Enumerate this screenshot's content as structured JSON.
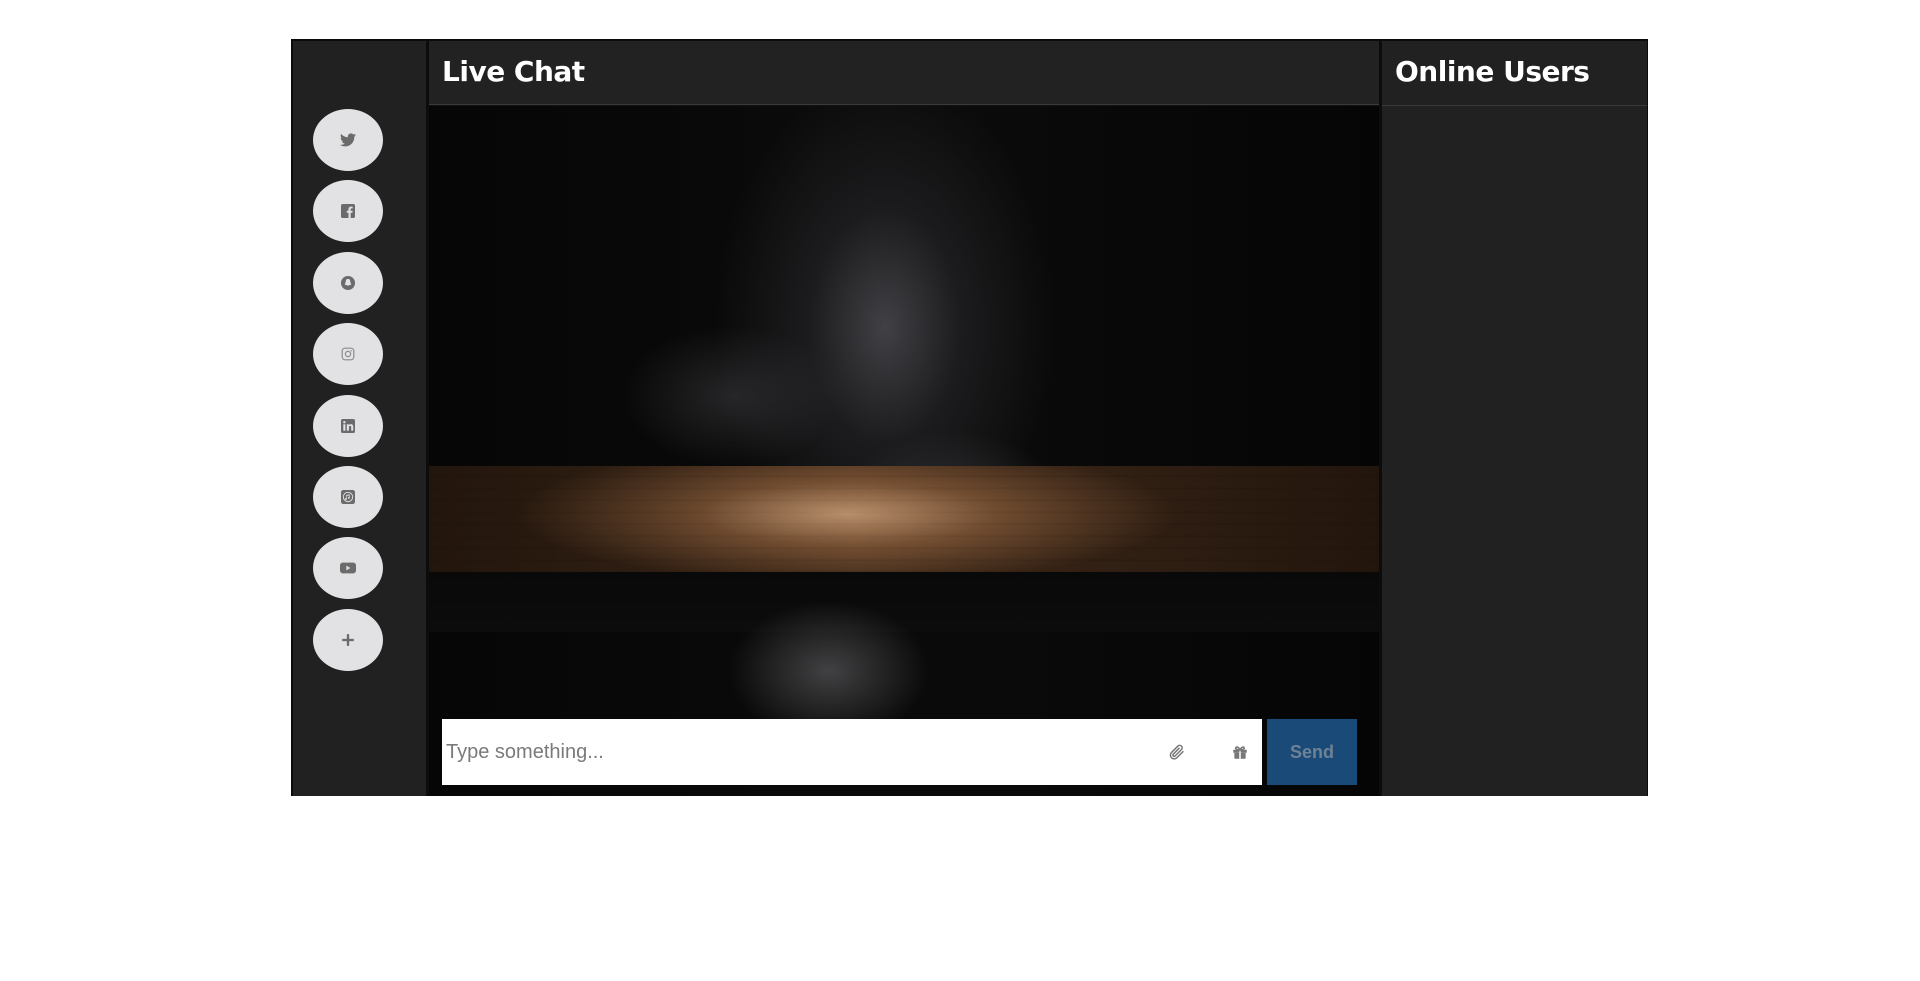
{
  "social": {
    "items": [
      {
        "name": "twitter",
        "icon": "twitter-icon"
      },
      {
        "name": "facebook",
        "icon": "facebook-icon"
      },
      {
        "name": "snapchat",
        "icon": "snapchat-icon"
      },
      {
        "name": "instagram",
        "icon": "instagram-icon"
      },
      {
        "name": "linkedin",
        "icon": "linkedin-icon"
      },
      {
        "name": "itunes",
        "icon": "itunes-icon"
      },
      {
        "name": "youtube",
        "icon": "youtube-icon"
      },
      {
        "name": "add",
        "icon": "plus-icon"
      }
    ]
  },
  "chat": {
    "title": "Live Chat",
    "input_placeholder": "Type something...",
    "input_value": "",
    "attach_icon": "paperclip-icon",
    "gift_icon": "gift-icon",
    "send_label": "Send"
  },
  "users": {
    "title": "Online Users",
    "list": []
  },
  "colors": {
    "sidebar_bg": "#212121",
    "social_button_bg": "#e2e2e4",
    "send_button_bg": "#1a4a78",
    "send_button_text": "#6f8195"
  }
}
